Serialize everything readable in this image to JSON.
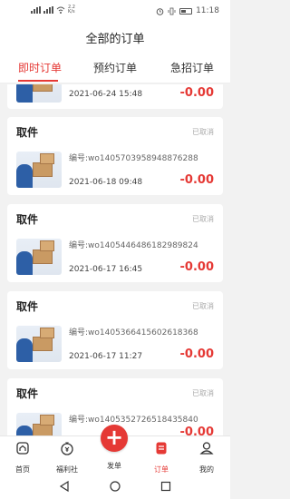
{
  "status_bar": {
    "network_speed": "2.2\nK/s",
    "time": "11:18",
    "icons": [
      "sim-signal-icon",
      "wifi-icon",
      "alarm-icon",
      "vibrate-icon",
      "battery-icon"
    ]
  },
  "header": {
    "title": "全部的订单"
  },
  "tabs": [
    {
      "label": "即时订单",
      "active": true
    },
    {
      "label": "预约订单",
      "active": false
    },
    {
      "label": "急招订单",
      "active": false
    }
  ],
  "partial_order": {
    "time": "2021-06-24 15:48",
    "amount": "-0.00"
  },
  "orders": [
    {
      "type": "取件",
      "status": "已取消",
      "number": "编号:wo1405703958948876288",
      "time": "2021-06-18 09:48",
      "amount": "-0.00"
    },
    {
      "type": "取件",
      "status": "已取消",
      "number": "编号:wo1405446486182989824",
      "time": "2021-06-17 16:45",
      "amount": "-0.00"
    },
    {
      "type": "取件",
      "status": "已取消",
      "number": "编号:wo1405366415602618368",
      "time": "2021-06-17 11:27",
      "amount": "-0.00"
    },
    {
      "type": "取件",
      "status": "已取消",
      "number": "编号:wo1405352726518435840",
      "time": "",
      "amount": "-0.00"
    }
  ],
  "bottom_nav": [
    {
      "label": "首页",
      "icon": "home-icon",
      "active": false
    },
    {
      "label": "福利社",
      "icon": "money-bag-icon",
      "active": false
    },
    {
      "label": "发单",
      "icon": "plus-icon",
      "active": false
    },
    {
      "label": "订单",
      "icon": "order-list-icon",
      "active": true
    },
    {
      "label": "我的",
      "icon": "profile-icon",
      "active": false
    }
  ],
  "fab": {
    "symbol": "+"
  },
  "colors": {
    "accent": "#e53935",
    "muted": "#aaaaaa",
    "background": "#f2f2f2"
  }
}
